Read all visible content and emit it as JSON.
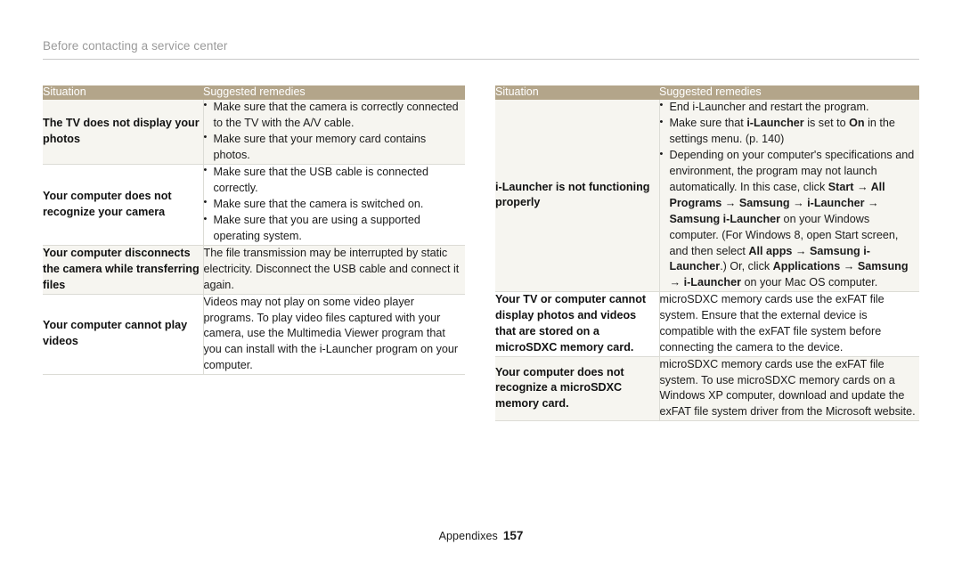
{
  "header": {
    "running_title": "Before contacting a service center"
  },
  "footer": {
    "section": "Appendixes",
    "page_number": "157"
  },
  "colors": {
    "table_header_bg": "#b3a58a",
    "table_header_text": "#ffffff",
    "row_shade_bg": "#f6f5f0",
    "row_plain_bg": "#ffffff",
    "border": "#dcdcd6",
    "running_header_text": "#9a9a9a",
    "rule": "#c9c9c9"
  },
  "left_table": {
    "columns": [
      "Situation",
      "Suggested remedies"
    ],
    "rows": [
      {
        "shaded": true,
        "situation": "The TV does not display your photos",
        "remedy_type": "bullets",
        "bullets": [
          "Make sure that the camera is correctly connected to the TV with the A/V cable.",
          "Make sure that your memory card contains photos."
        ]
      },
      {
        "shaded": false,
        "situation": "Your computer does not recognize your camera",
        "remedy_type": "bullets",
        "bullets": [
          "Make sure that the USB cable is connected correctly.",
          "Make sure that the camera is switched on.",
          "Make sure that you are using a supported operating system."
        ]
      },
      {
        "shaded": true,
        "situation": "Your computer disconnects the camera while transferring files",
        "remedy_type": "paragraph",
        "paragraph": "The file transmission may be interrupted by static electricity. Disconnect the USB cable and connect it again."
      },
      {
        "shaded": false,
        "situation": "Your computer cannot play videos",
        "remedy_type": "paragraph",
        "paragraph": "Videos may not play on some video player programs. To play video files captured with your camera, use the Multimedia Viewer program that you can install with the i-Launcher program on your computer."
      }
    ]
  },
  "right_table": {
    "columns": [
      "Situation",
      "Suggested remedies"
    ],
    "rows": [
      {
        "shaded": true,
        "situation": "i-Launcher is not functioning properly",
        "remedy_type": "bullets_rich",
        "bullets_rich": [
          [
            {
              "t": "End i-Launcher and restart the program.",
              "b": false
            }
          ],
          [
            {
              "t": "Make sure that ",
              "b": false
            },
            {
              "t": "i-Launcher",
              "b": true
            },
            {
              "t": " is set to ",
              "b": false
            },
            {
              "t": "On",
              "b": true
            },
            {
              "t": " in the settings menu. (p. 140)",
              "b": false
            }
          ],
          [
            {
              "t": "Depending on your computer's specifications and environment, the program may not launch automatically. In this case, click ",
              "b": false
            },
            {
              "t": "Start",
              "b": true
            },
            {
              "t": " → ",
              "b": true
            },
            {
              "t": "All Programs",
              "b": true
            },
            {
              "t": " → ",
              "b": true
            },
            {
              "t": "Samsung",
              "b": true
            },
            {
              "t": " → ",
              "b": true
            },
            {
              "t": "i-Launcher",
              "b": true
            },
            {
              "t": " → ",
              "b": true
            },
            {
              "t": "Samsung i-Launcher",
              "b": true
            },
            {
              "t": " on your Windows computer. (For Windows 8, open Start screen, and then select ",
              "b": false
            },
            {
              "t": "All apps",
              "b": true
            },
            {
              "t": " → ",
              "b": true
            },
            {
              "t": "Samsung i-Launcher",
              "b": true
            },
            {
              "t": ".) Or, click ",
              "b": false
            },
            {
              "t": "Applications",
              "b": true
            },
            {
              "t": " → ",
              "b": true
            },
            {
              "t": "Samsung",
              "b": true
            },
            {
              "t": " → ",
              "b": true
            },
            {
              "t": "i-Launcher",
              "b": true
            },
            {
              "t": " on your Mac OS computer.",
              "b": false
            }
          ]
        ]
      },
      {
        "shaded": false,
        "situation": "Your TV or computer cannot display photos and videos that are stored on a microSDXC memory card.",
        "remedy_type": "paragraph",
        "paragraph": "microSDXC memory cards use the exFAT file system. Ensure that the external device is compatible with the exFAT file system before connecting the camera to the device."
      },
      {
        "shaded": true,
        "situation": "Your computer does not recognize a microSDXC memory card.",
        "remedy_type": "paragraph",
        "paragraph": "microSDXC memory cards use the exFAT file system. To use microSDXC memory cards on a Windows XP computer, download and update the exFAT file system driver from the Microsoft website."
      }
    ]
  }
}
